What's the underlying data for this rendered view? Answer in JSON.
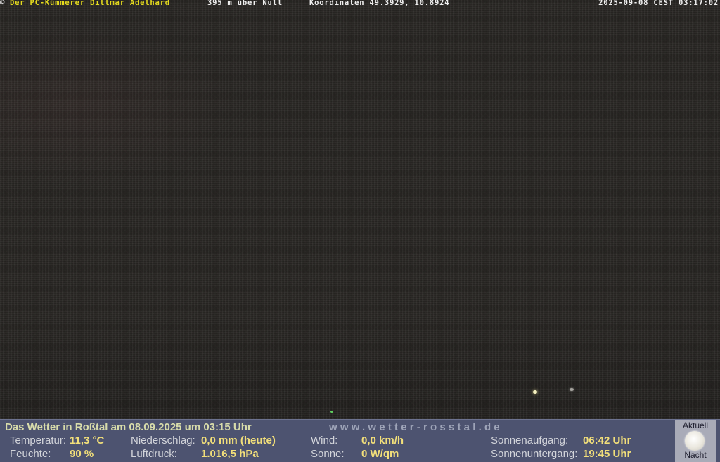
{
  "overlay": {
    "copyright": "©",
    "owner": "Der PC-Kümmerer Dittmar Adelhard",
    "altitude": "395 m über Null",
    "coordinates": "Koordinaten 49.3929, 10.8924",
    "timestamp": "2025-09-08 CEST 03:17:02"
  },
  "weather": {
    "header": "Das Wetter in Roßtal am 08.09.2025 um 03:15 Uhr",
    "url": "www.wetter-rosstal.de",
    "temperature": {
      "label": "Temperatur:",
      "value": "11,3 °C"
    },
    "humidity": {
      "label": "Feuchte:",
      "value": "90 %"
    },
    "precipitation": {
      "label": "Niederschlag:",
      "value": "0,0 mm (heute)"
    },
    "pressure": {
      "label": "Luftdruck:",
      "value": "1.016,5 hPa"
    },
    "wind": {
      "label": "Wind:",
      "value": "0,0 km/h"
    },
    "sun": {
      "label": "Sonne:",
      "value": "0 W/qm"
    },
    "sunrise": {
      "label": "Sonnenaufgang:",
      "value": "06:42 Uhr"
    },
    "sunset": {
      "label": "Sonnenuntergang:",
      "value": "19:45 Uhr"
    },
    "moon": {
      "top_label": "Aktuell",
      "bottom_label": "Nacht",
      "icon": "full-moon-icon"
    }
  },
  "colors": {
    "panel_bg": "#4d5370",
    "value_text": "#f2df7a",
    "owner_text": "#e6dc1e"
  }
}
